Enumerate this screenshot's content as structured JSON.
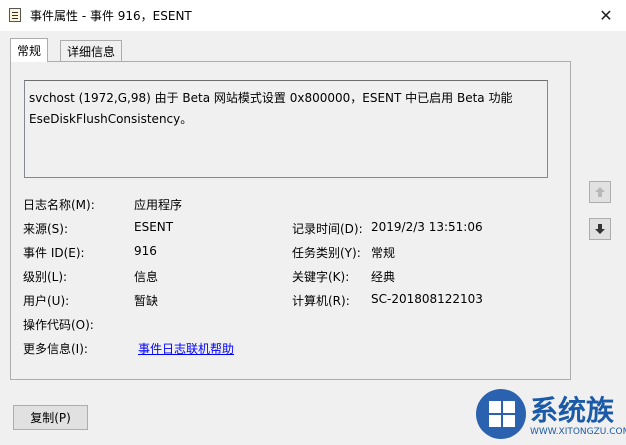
{
  "window": {
    "title": "事件属性 - 事件 916，ESENT",
    "close_glyph": "✕"
  },
  "tabs": [
    {
      "label": "常规",
      "active": true
    },
    {
      "label": "详细信息",
      "active": false
    }
  ],
  "description": {
    "line1": "svchost (1972,G,98) 由于 Beta 网站模式设置 0x800000，ESENT 中已启用 Beta 功能",
    "line2": "EseDiskFlushConsistency。"
  },
  "fields": {
    "log_name": {
      "label": "日志名称(M):",
      "value": "应用程序"
    },
    "source": {
      "label": "来源(S):",
      "value": "ESENT"
    },
    "event_id": {
      "label": "事件 ID(E):",
      "value": "916"
    },
    "level": {
      "label": "级别(L):",
      "value": "信息"
    },
    "user": {
      "label": "用户(U):",
      "value": "暂缺"
    },
    "opcode": {
      "label": "操作代码(O):",
      "value": ""
    },
    "more_info": {
      "label": "更多信息(I):",
      "value": "事件日志联机帮助"
    },
    "logged": {
      "label": "记录时间(D):",
      "value": "2019/2/3 13:51:06"
    },
    "task_category": {
      "label": "任务类别(Y):",
      "value": "常规"
    },
    "keywords": {
      "label": "关键字(K):",
      "value": "经典"
    },
    "computer": {
      "label": "计算机(R):",
      "value": "SC-201808122103"
    }
  },
  "nav": {
    "up_icon": "arrow-up-icon",
    "down_icon": "arrow-down-icon"
  },
  "copy_button": {
    "label": "复制(P)"
  },
  "watermark": {
    "brand": "系统族",
    "url": "WWW.XITONGZU.COM"
  }
}
